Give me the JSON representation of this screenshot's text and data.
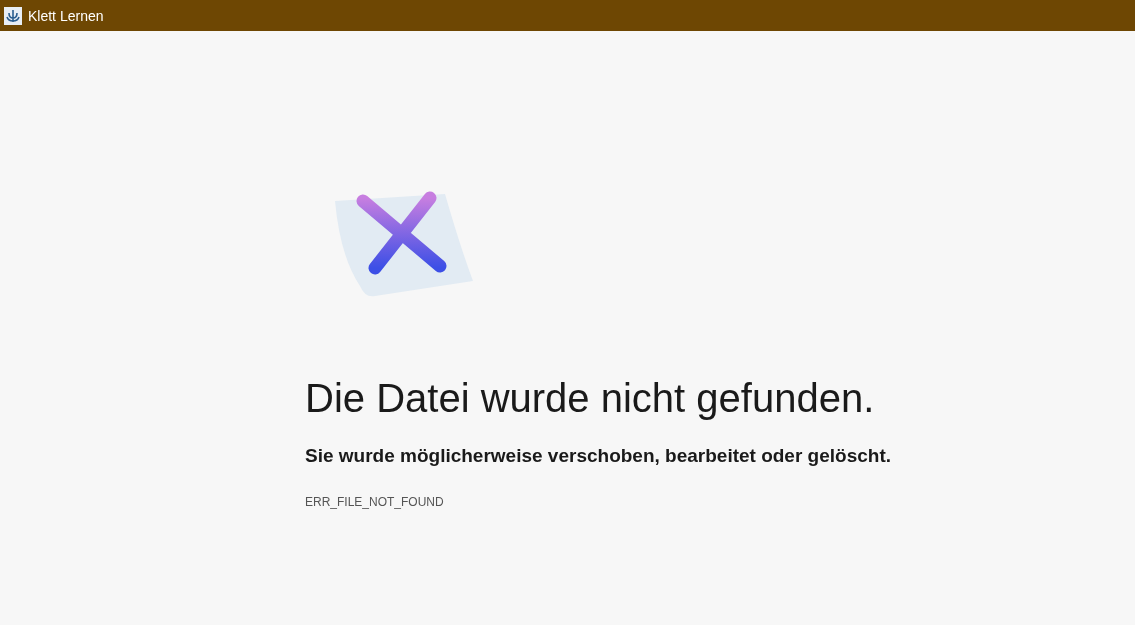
{
  "window": {
    "title": "Klett Lernen"
  },
  "error": {
    "heading": "Die Datei wurde nicht gefunden.",
    "message": "Sie wurde möglicherweise verschoben, bearbeitet oder gelöscht.",
    "code": "ERR_FILE_NOT_FOUND"
  }
}
